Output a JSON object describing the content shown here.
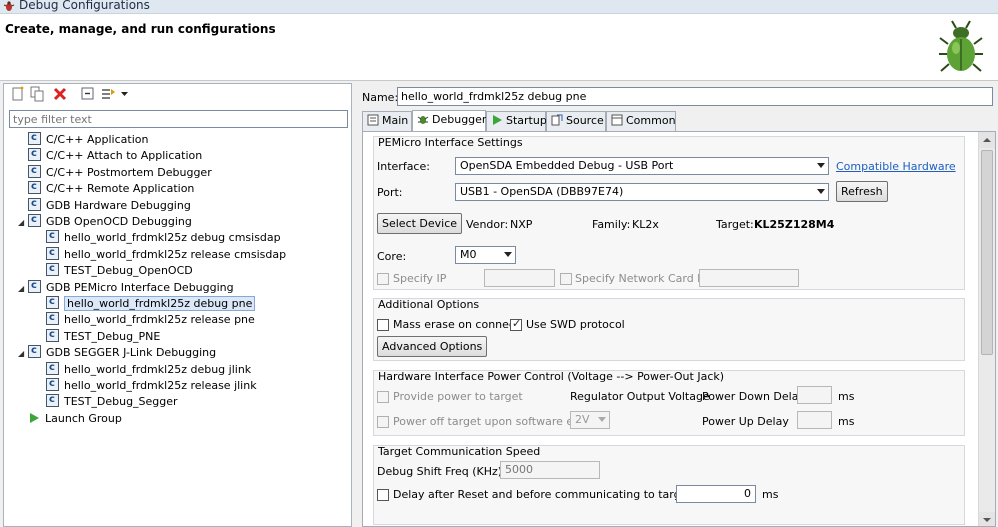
{
  "window": {
    "title": "Debug Configurations",
    "heading": "Create, manage, and run configurations"
  },
  "left": {
    "filter_placeholder": "type filter text",
    "tree": [
      {
        "label": "C/C++ Application",
        "level": 0,
        "expanded": null,
        "icon": "config-icon"
      },
      {
        "label": "C/C++ Attach to Application",
        "level": 0,
        "expanded": null,
        "icon": "config-icon"
      },
      {
        "label": "C/C++ Postmortem Debugger",
        "level": 0,
        "expanded": null,
        "icon": "config-icon"
      },
      {
        "label": "C/C++ Remote Application",
        "level": 0,
        "expanded": null,
        "icon": "config-icon"
      },
      {
        "label": "GDB Hardware Debugging",
        "level": 0,
        "expanded": null,
        "icon": "config-icon"
      },
      {
        "label": "GDB OpenOCD Debugging",
        "level": 0,
        "expanded": true,
        "icon": "config-icon"
      },
      {
        "label": "hello_world_frdmkl25z debug cmsisdap",
        "level": 1,
        "expanded": null,
        "icon": "config-icon"
      },
      {
        "label": "hello_world_frdmkl25z release cmsisdap",
        "level": 1,
        "expanded": null,
        "icon": "config-icon"
      },
      {
        "label": "TEST_Debug_OpenOCD",
        "level": 1,
        "expanded": null,
        "icon": "config-icon"
      },
      {
        "label": "GDB PEMicro Interface Debugging",
        "level": 0,
        "expanded": true,
        "icon": "config-icon"
      },
      {
        "label": "hello_world_frdmkl25z debug pne",
        "level": 1,
        "expanded": null,
        "icon": "config-icon",
        "selected": true
      },
      {
        "label": "hello_world_frdmkl25z release pne",
        "level": 1,
        "expanded": null,
        "icon": "config-icon"
      },
      {
        "label": "TEST_Debug_PNE",
        "level": 1,
        "expanded": null,
        "icon": "config-icon"
      },
      {
        "label": "GDB SEGGER J-Link Debugging",
        "level": 0,
        "expanded": true,
        "icon": "config-icon"
      },
      {
        "label": "hello_world_frdmkl25z debug jlink",
        "level": 1,
        "expanded": null,
        "icon": "config-icon"
      },
      {
        "label": "hello_world_frdmkl25z release jlink",
        "level": 1,
        "expanded": null,
        "icon": "config-icon"
      },
      {
        "label": "TEST_Debug_Segger",
        "level": 1,
        "expanded": null,
        "icon": "config-icon"
      },
      {
        "label": "Launch Group",
        "level": 0,
        "expanded": null,
        "icon": "launch-icon"
      }
    ]
  },
  "right": {
    "name_label": "Name:",
    "name_value": "hello_world_frdmkl25z debug pne",
    "tabs": [
      "Main",
      "Debugger",
      "Startup",
      "Source",
      "Common"
    ],
    "pemicro": {
      "title": "PEMicro Interface Settings",
      "interface_label": "Interface:",
      "interface_value": "OpenSDA Embedded Debug - USB Port",
      "compatible_link": "Compatible Hardware",
      "port_label": "Port:",
      "port_value": "USB1 - OpenSDA (DBB97E74)",
      "refresh": "Refresh",
      "select_device": "Select Device",
      "vendor_label": "Vendor:",
      "vendor_value": "NXP",
      "family_label": "Family:",
      "family_value": "KL2x",
      "target_label": "Target:",
      "target_value": "KL25Z128M4",
      "core_label": "Core:",
      "core_value": "M0",
      "specify_ip": "Specify IP",
      "specify_net": "Specify Network Card IP"
    },
    "additional": {
      "title": "Additional Options",
      "mass_erase": "Mass erase on connect",
      "use_swd": "Use SWD protocol",
      "advanced": "Advanced Options"
    },
    "power": {
      "title": "Hardware Interface Power Control (Voltage --> Power-Out Jack)",
      "provide": "Provide power to target",
      "regulator": "Regulator Output Voltage",
      "power_down": "Power Down Delay",
      "ms1": "ms",
      "poweroff": "Power off target upon software exit",
      "voltage": "2V",
      "power_up": "Power Up Delay",
      "ms2": "ms"
    },
    "comm": {
      "title": "Target Communication Speed",
      "shift_label": "Debug Shift Freq (KHz)",
      "shift_value": "5000",
      "delay_label": "Delay after Reset and before communicating to target for",
      "delay_value": "0",
      "ms": "ms"
    }
  }
}
